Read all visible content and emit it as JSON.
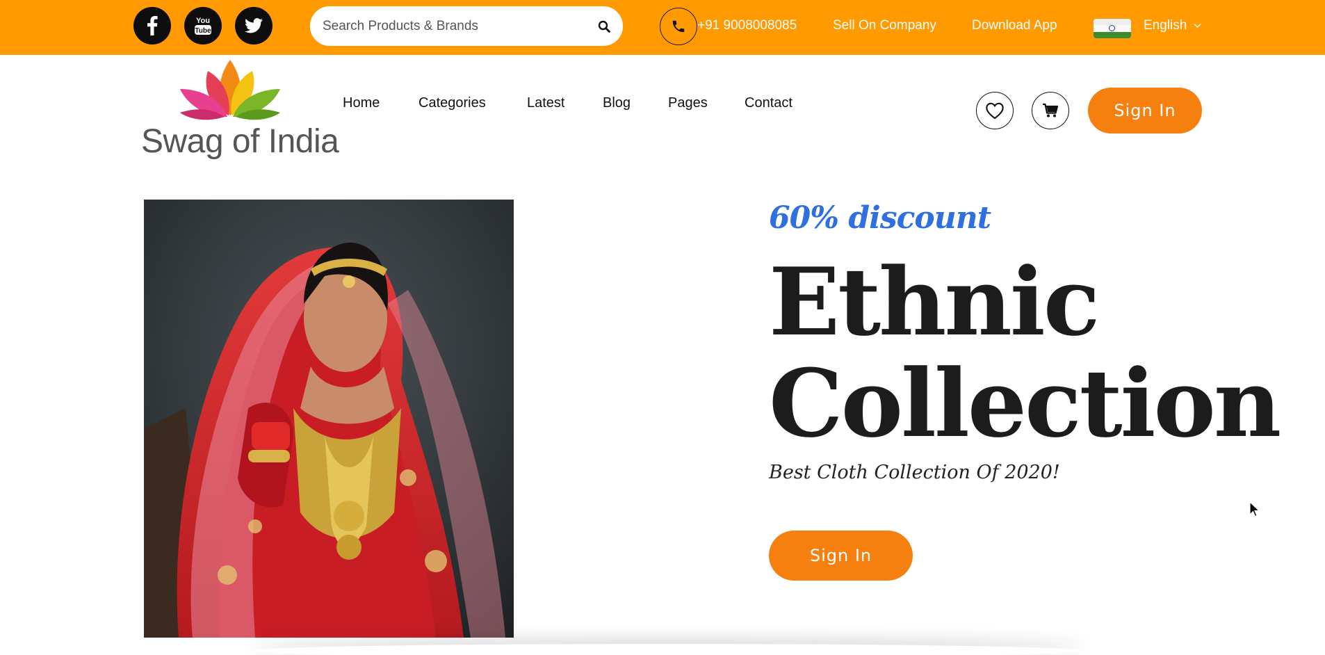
{
  "topbar": {
    "social": [
      {
        "name": "facebook",
        "icon": "facebook-icon"
      },
      {
        "name": "youtube",
        "icon": "youtube-icon",
        "glyph_top": "You",
        "glyph_bottom": "Tube"
      },
      {
        "name": "twitter",
        "icon": "twitter-icon"
      }
    ],
    "search": {
      "placeholder": "Search Products & Brands",
      "value": ""
    },
    "phone": "+91 9008008085",
    "sell_link": "Sell On Company",
    "download_link": "Download App",
    "language": "English",
    "background_color": "#ff9a03"
  },
  "header": {
    "logo_text": "Swag of India",
    "nav": [
      "Home",
      "Categories",
      "Latest",
      "Blog",
      "Pages",
      "Contact"
    ],
    "sign_in": "Sign In"
  },
  "hero": {
    "discount": "60% discount",
    "title_line1": "Ethnic",
    "title_line2": "Collection",
    "subtitle": "Best Cloth Collection Of 2020!",
    "cta": "Sign In"
  },
  "colors": {
    "accent": "#f5800f",
    "discount": "#2f6fe0",
    "text": "#1c1c1c"
  }
}
